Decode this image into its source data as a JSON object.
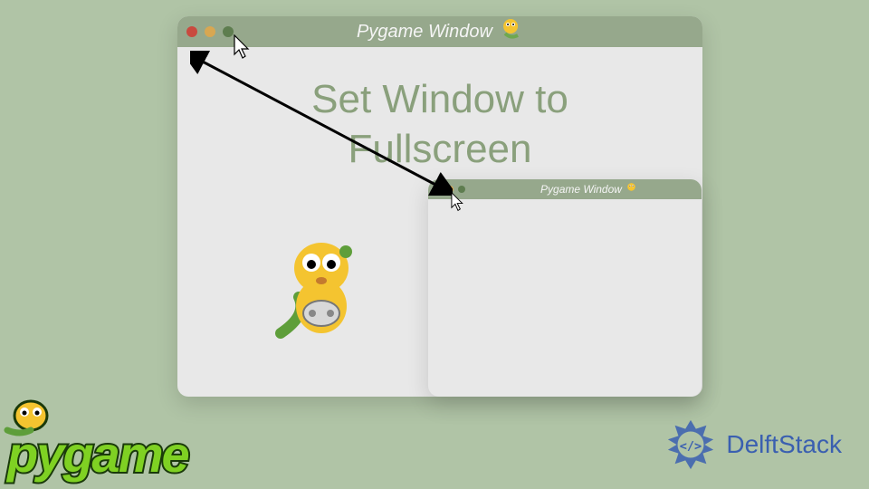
{
  "large_window": {
    "title": "Pygame Window"
  },
  "small_window": {
    "title": "Pygame Window"
  },
  "heading": {
    "line1": "Set Window to",
    "line2": "Fullscreen"
  },
  "logos": {
    "pygame": "pygame",
    "delftstack": "DelftStack"
  },
  "colors": {
    "bg": "#b0c4a6",
    "titlebar": "#96a88c",
    "heading": "#8aa07c",
    "delft": "#3a5fb0"
  }
}
